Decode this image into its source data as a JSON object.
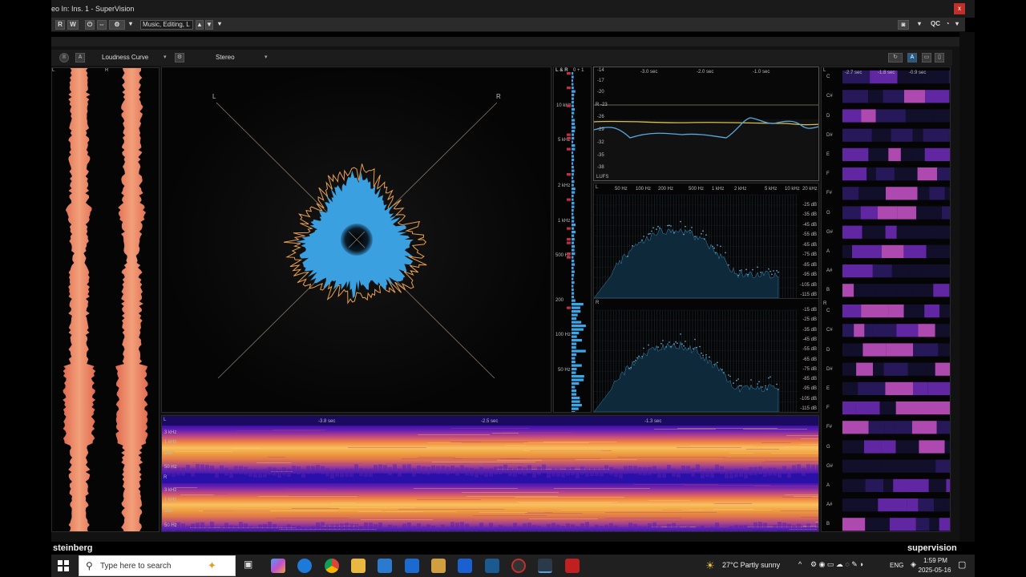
{
  "window": {
    "title": "eo In: Ins. 1 - SuperVision",
    "close_label": "x"
  },
  "host_toolbar": {
    "buttons": [
      "R",
      "W"
    ],
    "preset": "Music, Editing, L",
    "qc_label": "QC"
  },
  "module_bar": {
    "module_a": "Loudness Curve",
    "module_b": "Stereo",
    "a_badge": "A"
  },
  "waveform": {
    "left_label": "L",
    "right_label": "R"
  },
  "vectorscope": {
    "left_label": "L",
    "right_label": "R"
  },
  "frequency_bars": {
    "header": "L & R",
    "scale": "0  + 1",
    "labels": [
      "10 kHz",
      "5 kHz",
      "2 kHz",
      "1 kHz",
      "500 Hz",
      "200",
      "100 Hz",
      "50 Hz"
    ]
  },
  "loudness": {
    "time_labels": [
      "-3.0 sec",
      "-2.0 sec",
      "-1.0 sec"
    ],
    "y_labels": [
      "-14",
      "-17",
      "-20",
      "R -23",
      "-26",
      "-29",
      "-32",
      "-35",
      "-38"
    ],
    "unit": "LUFS"
  },
  "spectrum": {
    "freq_labels": [
      "50 Hz",
      "100 Hz",
      "200 Hz",
      "500 Hz",
      "1 kHz",
      "2 kHz",
      "5 kHz",
      "10 kHz",
      "20 kHz"
    ],
    "db_labels": [
      "-15 dB",
      "-25 dB",
      "-35 dB",
      "-45 dB",
      "-55 dB",
      "-65 dB",
      "-75 dB",
      "-85 dB",
      "-95 dB",
      "-105 dB",
      "-115 dB"
    ],
    "left_label": "L",
    "right_label": "R"
  },
  "spectrogram": {
    "time_labels": [
      "-3.8 sec",
      "-2.5 sec",
      "-1.3 sec"
    ],
    "freq_labels": [
      "3 kHz",
      "1 kHz",
      "250",
      "50 Hz"
    ],
    "left_label": "L",
    "right_label": "R"
  },
  "chromagram": {
    "time_labels": [
      "-2.7 sec",
      "-1.8 sec",
      "-0.9 sec"
    ],
    "notes": [
      "C",
      "C#",
      "D",
      "D#",
      "E",
      "F",
      "F#",
      "G",
      "G#",
      "A",
      "A#",
      "B"
    ],
    "left_label": "L",
    "right_label": "R"
  },
  "branding": {
    "left": "steinberg",
    "right": "supervision"
  },
  "taskbar": {
    "search_placeholder": "Type here to search",
    "weather": "27°C  Partly sunny",
    "lang": "ENG",
    "time": "1:59 PM",
    "date": "2025-05-16"
  },
  "colors": {
    "waveform": "#f08060",
    "scope_blue": "#3aa0e0",
    "scope_orange": "#e8a050",
    "bars_blue": "#3aa8e8",
    "bars_red": "#c03040"
  }
}
